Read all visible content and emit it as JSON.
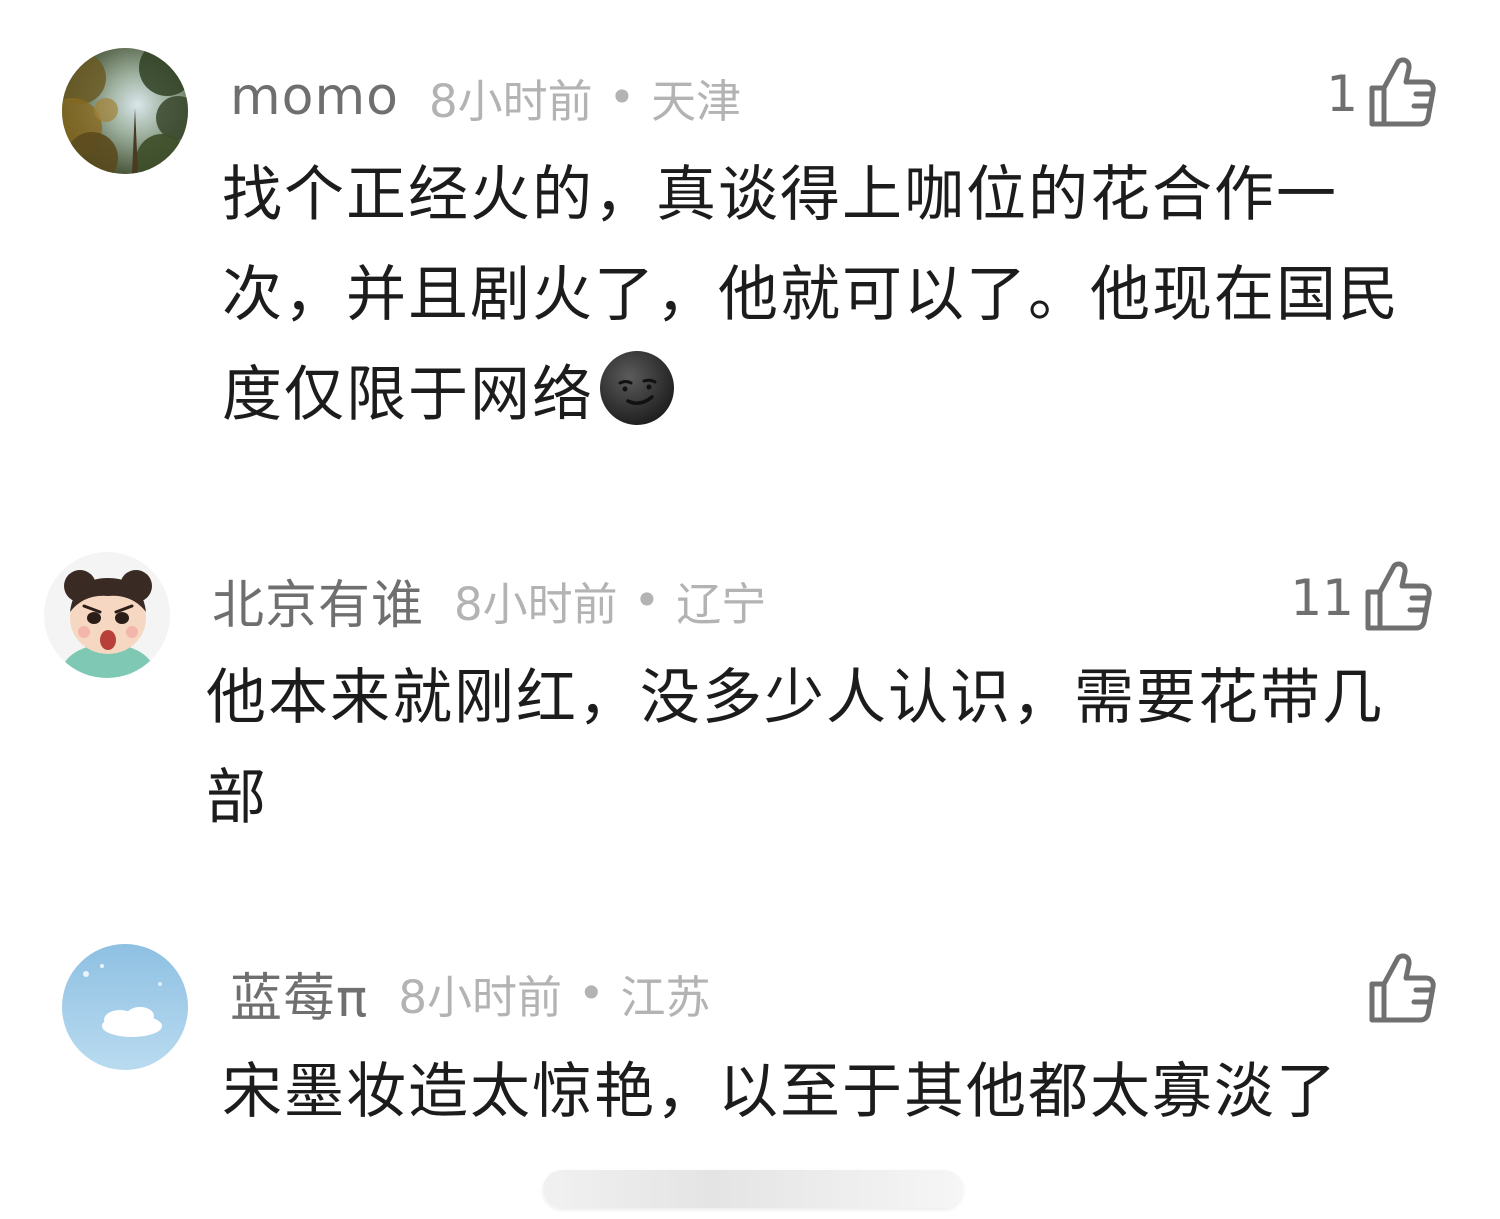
{
  "comments": [
    {
      "username": "momo",
      "time": "8小时前",
      "separator": "•",
      "location": "天津",
      "likes": "1",
      "text": "找个正经火的，真谈得上咖位的花合作一次，并且剧火了，他就可以了。他现在国民度仅限于网络",
      "emoji": "smirk-moon-icon"
    },
    {
      "username": "北京有谁",
      "time": "8小时前",
      "separator": "•",
      "location": "辽宁",
      "likes": "11",
      "text": "他本来就刚红，没多少人认识，需要花带几部"
    },
    {
      "username": "蓝莓π",
      "time": "8小时前",
      "separator": "•",
      "location": "江苏",
      "likes": "",
      "text": "宋墨妆造太惊艳，以至于其他都太寡淡了"
    }
  ],
  "colors": {
    "username": "#6f6f6f",
    "meta": "#b3b3b3",
    "body": "#1c1c1c",
    "icon": "#707070"
  }
}
